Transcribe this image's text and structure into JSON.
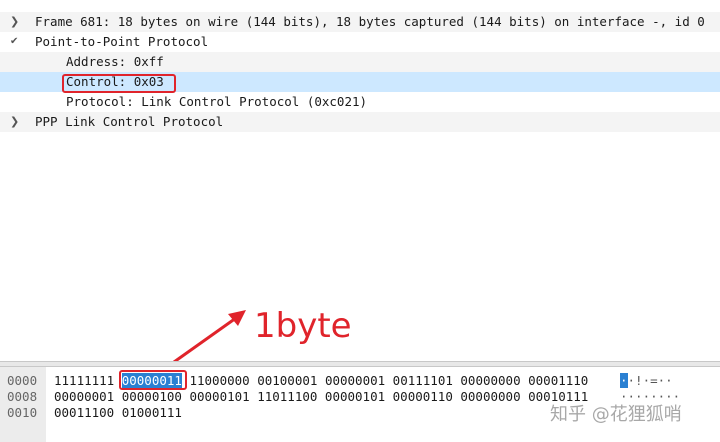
{
  "tree": {
    "frame_row": "Frame 681: 18 bytes on wire (144 bits), 18 bytes captured (144 bits) on interface -, id 0",
    "ppp_row": "Point-to-Point Protocol",
    "address_row": "Address: 0xff",
    "control_row": "Control: 0x03",
    "protocol_row": "Protocol: Link Control Protocol (0xc021)",
    "lcp_row": "PPP Link Control Protocol"
  },
  "annotation": {
    "label": "1byte",
    "color": "#e0242b"
  },
  "bytes": {
    "rows": [
      {
        "offset": "0000",
        "before": "11111111 ",
        "selected": "00000011",
        "after": " 11000000 00100001 00000001 00111101 00000000 00001110",
        "ascii_selected": "·",
        "ascii_rest": "·!·=··"
      },
      {
        "offset": "0008",
        "bits": "00000001 00000100 00000101 11011100 00000101 00000110 00000000 00010111",
        "ascii": "········"
      },
      {
        "offset": "0010",
        "bits": "00011100 01000111",
        "ascii": ""
      }
    ]
  },
  "watermark": "知乎 @花狸狐哨",
  "colors": {
    "selection_row": "#cde8ff",
    "selected_byte": "#2a80d2"
  }
}
